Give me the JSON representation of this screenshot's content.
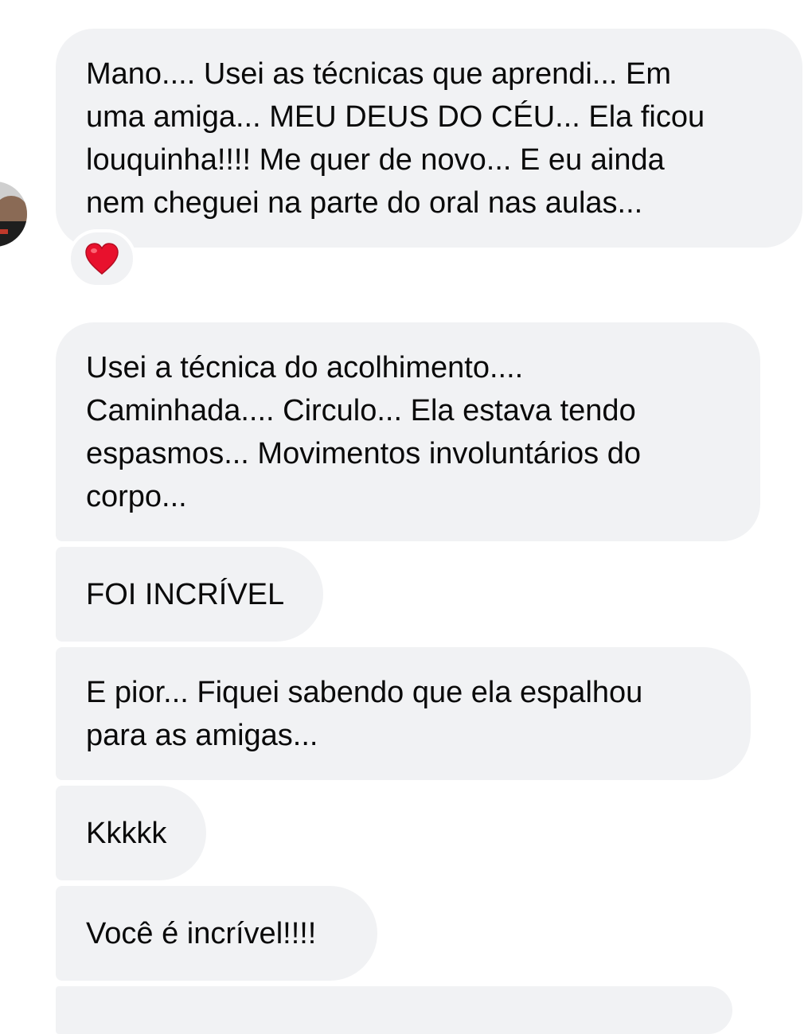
{
  "colors": {
    "bubble": "#f1f2f4",
    "text": "#0a0a0a",
    "heart": "#e8112d",
    "background": "#ffffff"
  },
  "reaction": {
    "icon": "red-heart-icon"
  },
  "messages": [
    {
      "text": "Mano.... Usei as técnicas que aprendi... Em\numa amiga... MEU DEUS DO CÉU... Ela ficou\nlouquinha!!!! Me quer de novo... E eu ainda\nnem cheguei na parte do oral nas aulas..."
    },
    {
      "text": "Usei a técnica do acolhimento....\nCaminhada.... Circulo... Ela estava tendo\nespasmos... Movimentos involuntários do\ncorpo..."
    },
    {
      "text": "FOI INCRÍVEL"
    },
    {
      "text": "E pior... Fiquei sabendo que ela espalhou\npara as amigas..."
    },
    {
      "text": "Kkkkk"
    },
    {
      "text": "Você é incrível!!!!"
    }
  ]
}
